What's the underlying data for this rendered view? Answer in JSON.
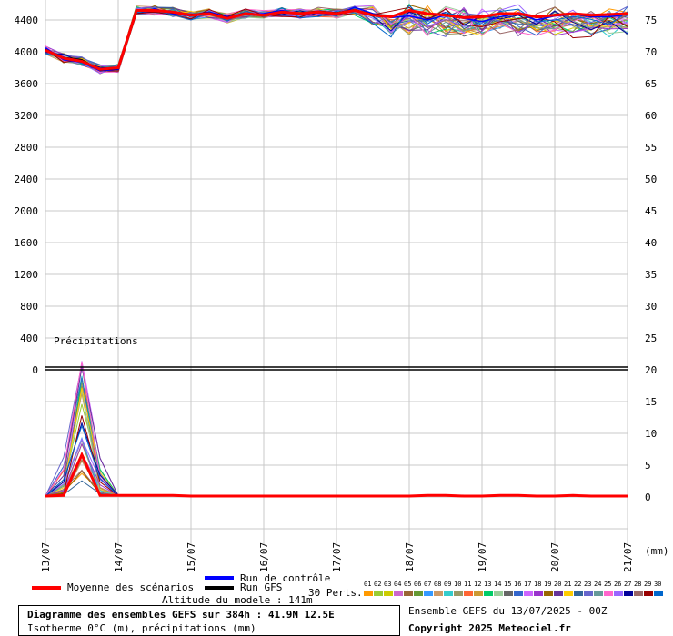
{
  "chart_data": {
    "type": "line",
    "title": "Diagramme des ensembles GEFS sur 384h : 41.9N 12.5E",
    "subtitle": "Isotherme 0°C (m), précipitations (mm)",
    "x_tick_labels": [
      "13/07",
      "14/07",
      "15/07",
      "16/07",
      "17/07",
      "18/07",
      "19/07",
      "20/07",
      "21/07"
    ],
    "x_unit_label": "(mm)",
    "left_axis": {
      "ticks": [
        4400,
        4000,
        3600,
        3200,
        2800,
        2400,
        2000,
        1600,
        1200,
        800,
        400,
        0
      ],
      "ylim": [
        0,
        4400
      ]
    },
    "right_axis": {
      "ticks": [
        75,
        70,
        65,
        60,
        55,
        50,
        45,
        40,
        35,
        30,
        25,
        20,
        15,
        10,
        5,
        0
      ]
    },
    "precip_panel_label": "Précipitations",
    "precip_axis": {
      "ylim": [
        0,
        20
      ]
    },
    "x_hours": [
      0,
      6,
      12,
      18,
      24,
      30,
      36,
      42,
      48,
      54,
      60,
      66,
      72,
      78,
      84,
      90,
      96,
      102,
      108,
      114,
      120,
      126,
      132,
      138,
      144,
      150,
      156,
      162,
      168,
      174,
      180,
      186,
      192
    ],
    "series": [
      {
        "name": "Moyenne des scénarios",
        "color": "#ff0000",
        "values": [
          4020,
          3920,
          3880,
          3780,
          3800,
          4520,
          4520,
          4500,
          4460,
          4480,
          4420,
          4480,
          4460,
          4500,
          4480,
          4500,
          4480,
          4520,
          4460,
          4440,
          4520,
          4480,
          4460,
          4430,
          4440,
          4480,
          4480,
          4440,
          4460,
          4480,
          4460,
          4470,
          4480
        ]
      },
      {
        "name": "Run de contrôle",
        "color": "#0000ff",
        "values": [
          4050,
          3900,
          3870,
          3760,
          3780,
          4510,
          4540,
          4480,
          4450,
          4500,
          4440,
          4470,
          4480,
          4520,
          4470,
          4490,
          4460,
          4560,
          4480,
          4430,
          4450,
          4400,
          4460,
          4420,
          4380,
          4440,
          4480,
          4400,
          4450,
          4470,
          4440,
          4440,
          4470
        ]
      },
      {
        "name": "Run GFS",
        "color": "#000000",
        "values": [
          4030,
          3930,
          3900,
          3770,
          3790,
          4530,
          4520,
          4490,
          4470,
          4490,
          4430,
          4490,
          4460,
          4490,
          4490,
          4510,
          4490,
          4530,
          4470,
          4450,
          4510,
          4470,
          4470,
          4440,
          4450,
          4470,
          4490,
          4430,
          4470,
          4470,
          4450,
          4470,
          4480
        ]
      }
    ],
    "precip_series": [
      {
        "name": "Moyenne des scénarios",
        "color": "#ff0000",
        "values": [
          0,
          0.1,
          6.5,
          0.1,
          0.1,
          0.1,
          0.1,
          0.1,
          0,
          0,
          0,
          0,
          0,
          0,
          0,
          0,
          0,
          0,
          0,
          0,
          0,
          0.1,
          0.1,
          0,
          0,
          0.1,
          0.1,
          0,
          0,
          0.1,
          0,
          0,
          0
        ]
      }
    ]
  },
  "legend": {
    "mean_label": "Moyenne des scénarios",
    "control_label": "Run de contrôle",
    "gfs_label": "Run GFS",
    "altitude_label": "Altitude du modele : 141m",
    "perts_label": "30 Perts.",
    "pert_numbers": [
      "01",
      "02",
      "03",
      "04",
      "05",
      "06",
      "07",
      "08",
      "09",
      "10",
      "11",
      "12",
      "13",
      "14",
      "15",
      "16",
      "17",
      "18",
      "19",
      "20",
      "21",
      "22",
      "23",
      "24",
      "25",
      "26",
      "27",
      "28",
      "29",
      "30"
    ],
    "pert_colors": [
      "#ff9900",
      "#99cc33",
      "#cccc00",
      "#cc66cc",
      "#996633",
      "#669933",
      "#3399ff",
      "#cc9966",
      "#33cccc",
      "#999966",
      "#ff6633",
      "#cc9933",
      "#00cc66",
      "#99cc99",
      "#666666",
      "#3366cc",
      "#cc66ff",
      "#9933cc",
      "#996600",
      "#663399",
      "#ffcc00",
      "#336699",
      "#6666cc",
      "#669999",
      "#ff66cc",
      "#9966ff",
      "#000099",
      "#996666",
      "#990000",
      "#0066cc"
    ]
  },
  "footer": {
    "title": "Diagramme des ensembles GEFS sur 384h : 41.9N 12.5E",
    "subtitle": "Isotherme 0°C (m), précipitations (mm)",
    "run_label": "Ensemble GEFS du 13/07/2025 - 00Z",
    "copyright": "Copyright 2025 Meteociel.fr"
  }
}
